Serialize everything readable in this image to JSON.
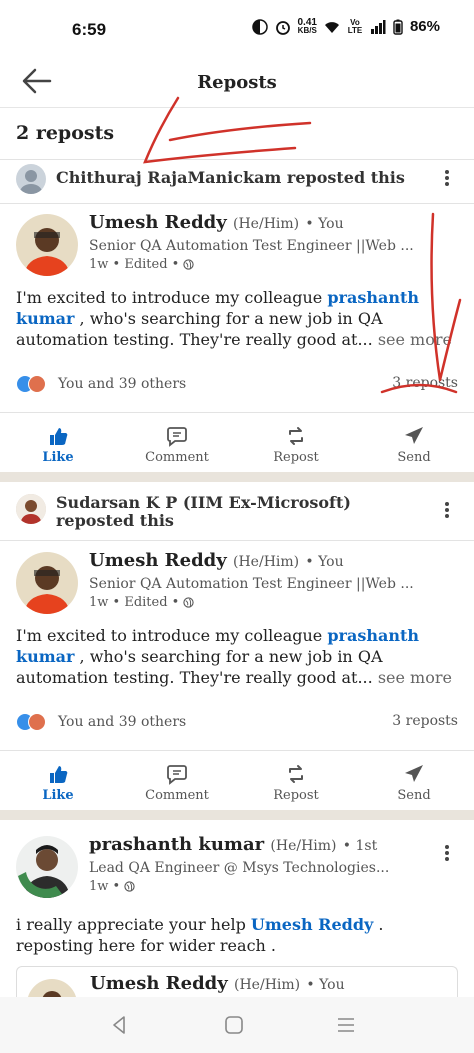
{
  "status_bar": {
    "time": "6:59",
    "speed_value": "0.41",
    "speed_unit": "KB/S",
    "network": "Vo LTE",
    "battery": "86%"
  },
  "header": {
    "title": "Reposts",
    "back_icon": "arrow-left-icon"
  },
  "repost_count": "2 reposts",
  "items": [
    {
      "reposter_line": "Chithuraj RajaManickam reposted this",
      "author": {
        "name": "Umesh Reddy",
        "pronouns": "(He/Him)",
        "degree": "• You",
        "headline": "Senior QA Automation Test Engineer ||Web ...",
        "meta": "1w • Edited •"
      },
      "body": {
        "text1": "I'm excited to introduce my colleague ",
        "mention": "prashanth kumar",
        "text2": " , who's searching for a new job in QA automation testing. They're really good at",
        "ellipsis": "...",
        "see_more": " see more"
      },
      "reactions": {
        "summary": "You and 39 others",
        "reposts": "3 reposts"
      }
    },
    {
      "reposter_line": "Sudarsan K P (IIM Ex-Microsoft) reposted this",
      "author": {
        "name": "Umesh Reddy",
        "pronouns": "(He/Him)",
        "degree": "• You",
        "headline": "Senior QA Automation Test Engineer ||Web ...",
        "meta": "1w • Edited •"
      },
      "body": {
        "text1": "I'm excited to introduce my colleague ",
        "mention": "prashanth kumar",
        "text2": " , who's searching for a new job in QA automation testing. They're really good at",
        "ellipsis": "...",
        "see_more": " see more"
      },
      "reactions": {
        "summary": "You and 39 others",
        "reposts": "3 reposts"
      }
    }
  ],
  "actions": {
    "like": "Like",
    "comment": "Comment",
    "repost": "Repost",
    "send": "Send"
  },
  "third_post": {
    "author": {
      "name": "prashanth kumar",
      "pronouns": "(He/Him)",
      "degree": "• 1st",
      "headline": "Lead QA Engineer @ Msys Technologies...",
      "meta": "1w •",
      "badge": "#OPENTOWORK"
    },
    "body": {
      "text1": "i really appreciate your help ",
      "mention": "Umesh Reddy",
      "text2": " . reposting here for wider reach ."
    },
    "quoted": {
      "name": "Umesh Reddy",
      "pronouns": "(He/Him)",
      "degree": "• You"
    }
  },
  "nav": {
    "back": "nav-back-icon",
    "home": "nav-home-icon",
    "recents": "nav-recents-icon"
  },
  "colors": {
    "link": "#0a66c2",
    "annotation": "#d0322a",
    "separator": "#e9e4dc"
  }
}
